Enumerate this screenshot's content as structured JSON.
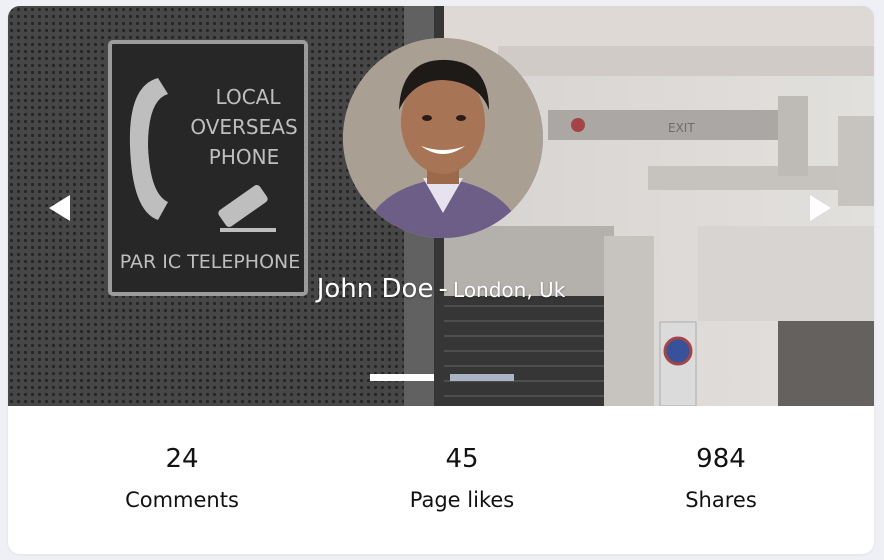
{
  "profile": {
    "name": "John Doe",
    "separator": "-",
    "location": "London, Uk"
  },
  "hero": {
    "sign_lines": [
      "LOCAL",
      "OVERSEAS",
      "PHONE"
    ],
    "sign_footer": "PAR   IC TELEPHONE",
    "exit_sign": "EXIT",
    "slide_count": 2,
    "active_slide": 1
  },
  "stats": [
    {
      "value": "24",
      "label": "Comments"
    },
    {
      "value": "45",
      "label": "Page likes"
    },
    {
      "value": "984",
      "label": "Shares"
    }
  ],
  "icons": {
    "prev": "triangle-left-icon",
    "next": "triangle-right-icon"
  },
  "colors": {
    "card": "#ffffff",
    "page_background": "#eef0f5",
    "indicator_active": "#ffffff",
    "indicator_inactive": "#aab4c4",
    "text": "#111111"
  }
}
